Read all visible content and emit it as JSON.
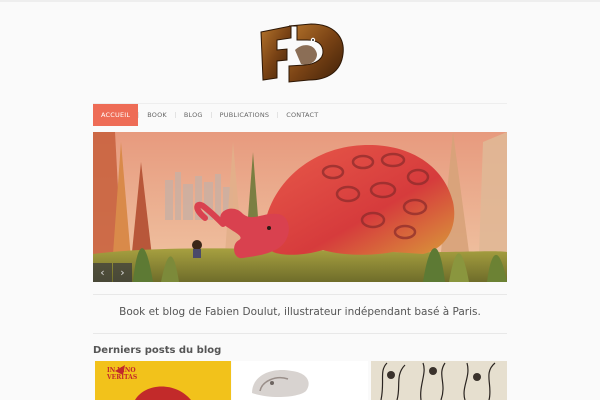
{
  "site": {
    "logo_icon": "fd-monogram-logo"
  },
  "nav": {
    "items": [
      {
        "label": "ACCUEIL",
        "active": true
      },
      {
        "label": "BOOK",
        "active": false
      },
      {
        "label": "BLOG",
        "active": false
      },
      {
        "label": "PUBLICATIONS",
        "active": false
      },
      {
        "label": "CONTACT",
        "active": false
      }
    ],
    "active_color": "#ee6c56"
  },
  "slider": {
    "prev_icon": "chevron-left-icon",
    "next_icon": "chevron-right-icon",
    "prev_glyph": "‹",
    "next_glyph": "›"
  },
  "tagline": "Book et blog de Fabien Doulut, illustrateur indépendant basé à Paris.",
  "blog": {
    "title": "Derniers posts du blog",
    "posts": [
      {
        "thumb_text": "IN VINO VERITAS"
      },
      {
        "thumb_text": ""
      },
      {
        "thumb_text": ""
      }
    ]
  }
}
